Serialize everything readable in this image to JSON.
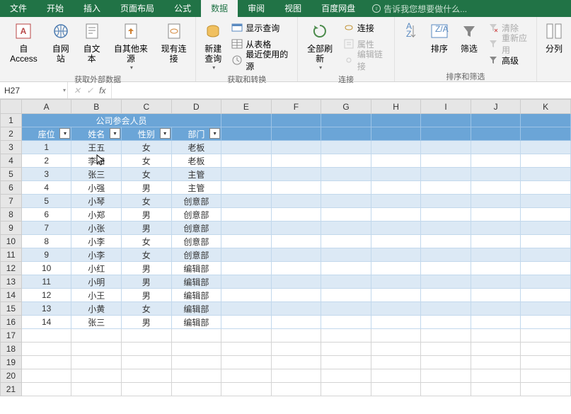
{
  "tabs": {
    "file": "文件",
    "home": "开始",
    "insert": "插入",
    "pagelayout": "页面布局",
    "formulas": "公式",
    "data": "数据",
    "review": "审阅",
    "view": "视图",
    "baidu": "百度网盘",
    "tellme": "告诉我您想要做什么..."
  },
  "ribbon": {
    "access": "自 Access",
    "web": "自网站",
    "text": "自文本",
    "other": "自其他来源",
    "existing": "现有连接",
    "group_external": "获取外部数据",
    "newquery": "新建\n查询",
    "showquery": "显示查询",
    "fromtable": "从表格",
    "recent": "最近使用的源",
    "group_transform": "获取和转换",
    "refresh": "全部刷新",
    "connections": "连接",
    "properties": "属性",
    "editlinks": "编辑链接",
    "group_conn": "连接",
    "sortaz": "排序",
    "filter": "筛选",
    "clear": "清除",
    "reapply": "重新应用",
    "advanced": "高级",
    "group_sortfilter": "排序和筛选",
    "split": "分列"
  },
  "namebox": "H27",
  "fx": "fx",
  "columns": [
    "A",
    "B",
    "C",
    "D",
    "E",
    "F",
    "G",
    "H",
    "I",
    "J",
    "K"
  ],
  "title": "公司参会人员",
  "headers": {
    "seat": "座位",
    "name": "姓名",
    "gender": "性别",
    "dept": "部门"
  },
  "rows": [
    {
      "seat": "1",
      "name": "王五",
      "gender": "女",
      "dept": "老板"
    },
    {
      "seat": "2",
      "name": "李四",
      "gender": "女",
      "dept": "老板"
    },
    {
      "seat": "3",
      "name": "张三",
      "gender": "女",
      "dept": "主管"
    },
    {
      "seat": "4",
      "name": "小强",
      "gender": "男",
      "dept": "主管"
    },
    {
      "seat": "5",
      "name": "小琴",
      "gender": "女",
      "dept": "创意部"
    },
    {
      "seat": "6",
      "name": "小郑",
      "gender": "男",
      "dept": "创意部"
    },
    {
      "seat": "7",
      "name": "小张",
      "gender": "男",
      "dept": "创意部"
    },
    {
      "seat": "8",
      "name": "小李",
      "gender": "女",
      "dept": "创意部"
    },
    {
      "seat": "9",
      "name": "小李",
      "gender": "女",
      "dept": "创意部"
    },
    {
      "seat": "10",
      "name": "小红",
      "gender": "男",
      "dept": "编辑部"
    },
    {
      "seat": "11",
      "name": "小明",
      "gender": "男",
      "dept": "编辑部"
    },
    {
      "seat": "12",
      "name": "小王",
      "gender": "男",
      "dept": "编辑部"
    },
    {
      "seat": "13",
      "name": "小黄",
      "gender": "女",
      "dept": "编辑部"
    },
    {
      "seat": "14",
      "name": "张三",
      "gender": "男",
      "dept": "编辑部"
    }
  ]
}
